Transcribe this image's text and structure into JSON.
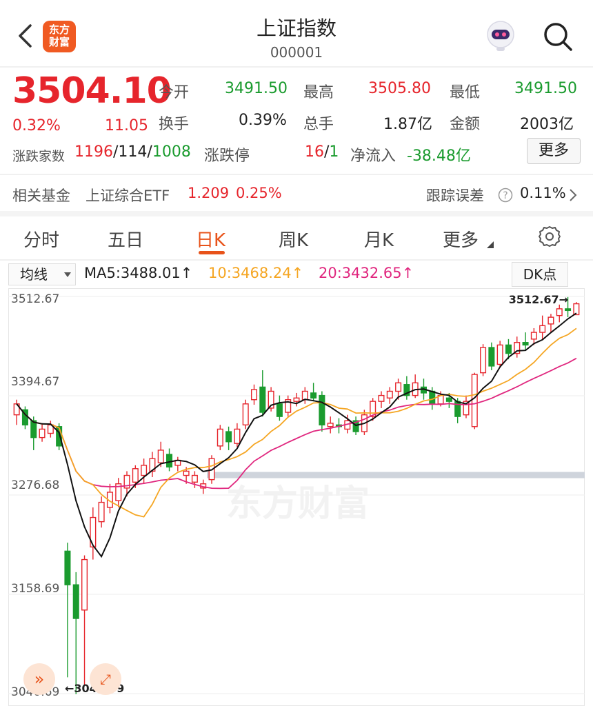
{
  "header": {
    "title": "上证指数",
    "code": "000001",
    "logo_text": "东方财富",
    "icons": [
      "back-arrow-icon",
      "robot-avatar-icon",
      "search-icon"
    ]
  },
  "quote": {
    "price": "3504.10",
    "change_pct": "0.32%",
    "change": "11.05",
    "open_label": "今开",
    "open": "3491.50",
    "high_label": "最高",
    "high": "3505.80",
    "low_label": "最低",
    "low": "3491.50",
    "turnover_label": "换手",
    "turnover": "0.39%",
    "volume_label": "总手",
    "volume": "1.87亿",
    "amount_label": "金额",
    "amount": "2003亿",
    "breadth_label": "涨跌家数",
    "up": "1196",
    "flat": "114",
    "down": "1008",
    "limit_label": "涨跌停",
    "limit_up": "16",
    "limit_down": "1",
    "netflow_label": "净流入",
    "netflow": "-38.48亿",
    "more_label": "更多"
  },
  "fund": {
    "label": "相关基金",
    "name": "上证综合ETF",
    "price": "1.209",
    "pct": "0.25%",
    "tracking_label": "跟踪误差",
    "tracking": "0.11%"
  },
  "tabs": [
    "分时",
    "五日",
    "日K",
    "周K",
    "月K",
    "更多"
  ],
  "active_tab": "日K",
  "chart_controls": {
    "indicator": "均线",
    "ma5": "MA5:3488.01↑",
    "ma10": "10:3468.24↑",
    "ma20": "20:3432.65↑",
    "dk": "DK点"
  },
  "colors": {
    "up": "#e6252c",
    "down": "#1a9b2e",
    "accent": "#e8531a",
    "ma5": "#111111",
    "ma10": "#f5a623",
    "ma20": "#e0267e"
  },
  "chart_data": {
    "type": "candlestick",
    "y_ticks": [
      "3512.67",
      "3394.67",
      "3276.68",
      "3158.69",
      "3040.69"
    ],
    "ylim": [
      3040.69,
      3512.67
    ],
    "max_label": "3512.67→",
    "min_label": "←3040.69",
    "watermark": "东方财富",
    "candles": [
      [
        3372,
        3385,
        3360,
        3390
      ],
      [
        3378,
        3360,
        3355,
        3382
      ],
      [
        3365,
        3345,
        3330,
        3370
      ],
      [
        3345,
        3355,
        3340,
        3362
      ],
      [
        3350,
        3360,
        3345,
        3365
      ],
      [
        3358,
        3335,
        3330,
        3362
      ],
      [
        3210,
        3170,
        3060,
        3220
      ],
      [
        3170,
        3130,
        3040,
        3185
      ],
      [
        3140,
        3200,
        3050,
        3205
      ],
      [
        3215,
        3250,
        3200,
        3262
      ],
      [
        3245,
        3268,
        3238,
        3275
      ],
      [
        3262,
        3280,
        3255,
        3290
      ],
      [
        3270,
        3290,
        3262,
        3297
      ],
      [
        3285,
        3300,
        3275,
        3305
      ],
      [
        3292,
        3308,
        3285,
        3312
      ],
      [
        3300,
        3312,
        3290,
        3320
      ],
      [
        3305,
        3320,
        3298,
        3328
      ],
      [
        3315,
        3330,
        3310,
        3340
      ],
      [
        3325,
        3310,
        3305,
        3332
      ],
      [
        3312,
        3318,
        3305,
        3322
      ],
      [
        3300,
        3305,
        3290,
        3310
      ],
      [
        3292,
        3300,
        3285,
        3305
      ],
      [
        3285,
        3290,
        3278,
        3295
      ],
      [
        3295,
        3320,
        3290,
        3324
      ],
      [
        3335,
        3355,
        3330,
        3360
      ],
      [
        3352,
        3340,
        3330,
        3358
      ],
      [
        3338,
        3355,
        3334,
        3362
      ],
      [
        3360,
        3385,
        3355,
        3390
      ],
      [
        3390,
        3402,
        3384,
        3408
      ],
      [
        3405,
        3375,
        3370,
        3425
      ],
      [
        3380,
        3400,
        3376,
        3405
      ],
      [
        3385,
        3370,
        3365,
        3395
      ],
      [
        3375,
        3390,
        3370,
        3395
      ],
      [
        3388,
        3392,
        3382,
        3398
      ],
      [
        3390,
        3400,
        3385,
        3405
      ],
      [
        3398,
        3392,
        3388,
        3410
      ],
      [
        3395,
        3360,
        3352,
        3400
      ],
      [
        3358,
        3362,
        3350,
        3370
      ],
      [
        3360,
        3358,
        3350,
        3368
      ],
      [
        3355,
        3365,
        3350,
        3372
      ],
      [
        3365,
        3352,
        3348,
        3370
      ],
      [
        3352,
        3372,
        3348,
        3378
      ],
      [
        3370,
        3388,
        3365,
        3392
      ],
      [
        3388,
        3395,
        3380,
        3400
      ],
      [
        3392,
        3400,
        3385,
        3405
      ],
      [
        3400,
        3410,
        3390,
        3415
      ],
      [
        3408,
        3395,
        3390,
        3418
      ],
      [
        3395,
        3410,
        3392,
        3420
      ],
      [
        3405,
        3398,
        3390,
        3415
      ],
      [
        3400,
        3385,
        3378,
        3405
      ],
      [
        3385,
        3395,
        3382,
        3400
      ],
      [
        3392,
        3388,
        3380,
        3398
      ],
      [
        3388,
        3370,
        3362,
        3392
      ],
      [
        3372,
        3388,
        3368,
        3395
      ],
      [
        3358,
        3420,
        3355,
        3422
      ],
      [
        3422,
        3452,
        3418,
        3456
      ],
      [
        3452,
        3430,
        3425,
        3458
      ],
      [
        3432,
        3455,
        3428,
        3460
      ],
      [
        3455,
        3445,
        3438,
        3462
      ],
      [
        3445,
        3458,
        3440,
        3465
      ],
      [
        3458,
        3455,
        3448,
        3470
      ],
      [
        3462,
        3470,
        3455,
        3475
      ],
      [
        3470,
        3478,
        3462,
        3490
      ],
      [
        3480,
        3488,
        3470,
        3492
      ],
      [
        3490,
        3498,
        3482,
        3503
      ],
      [
        3498,
        3496,
        3488,
        3512
      ],
      [
        3491,
        3504,
        3491,
        3506
      ]
    ]
  }
}
